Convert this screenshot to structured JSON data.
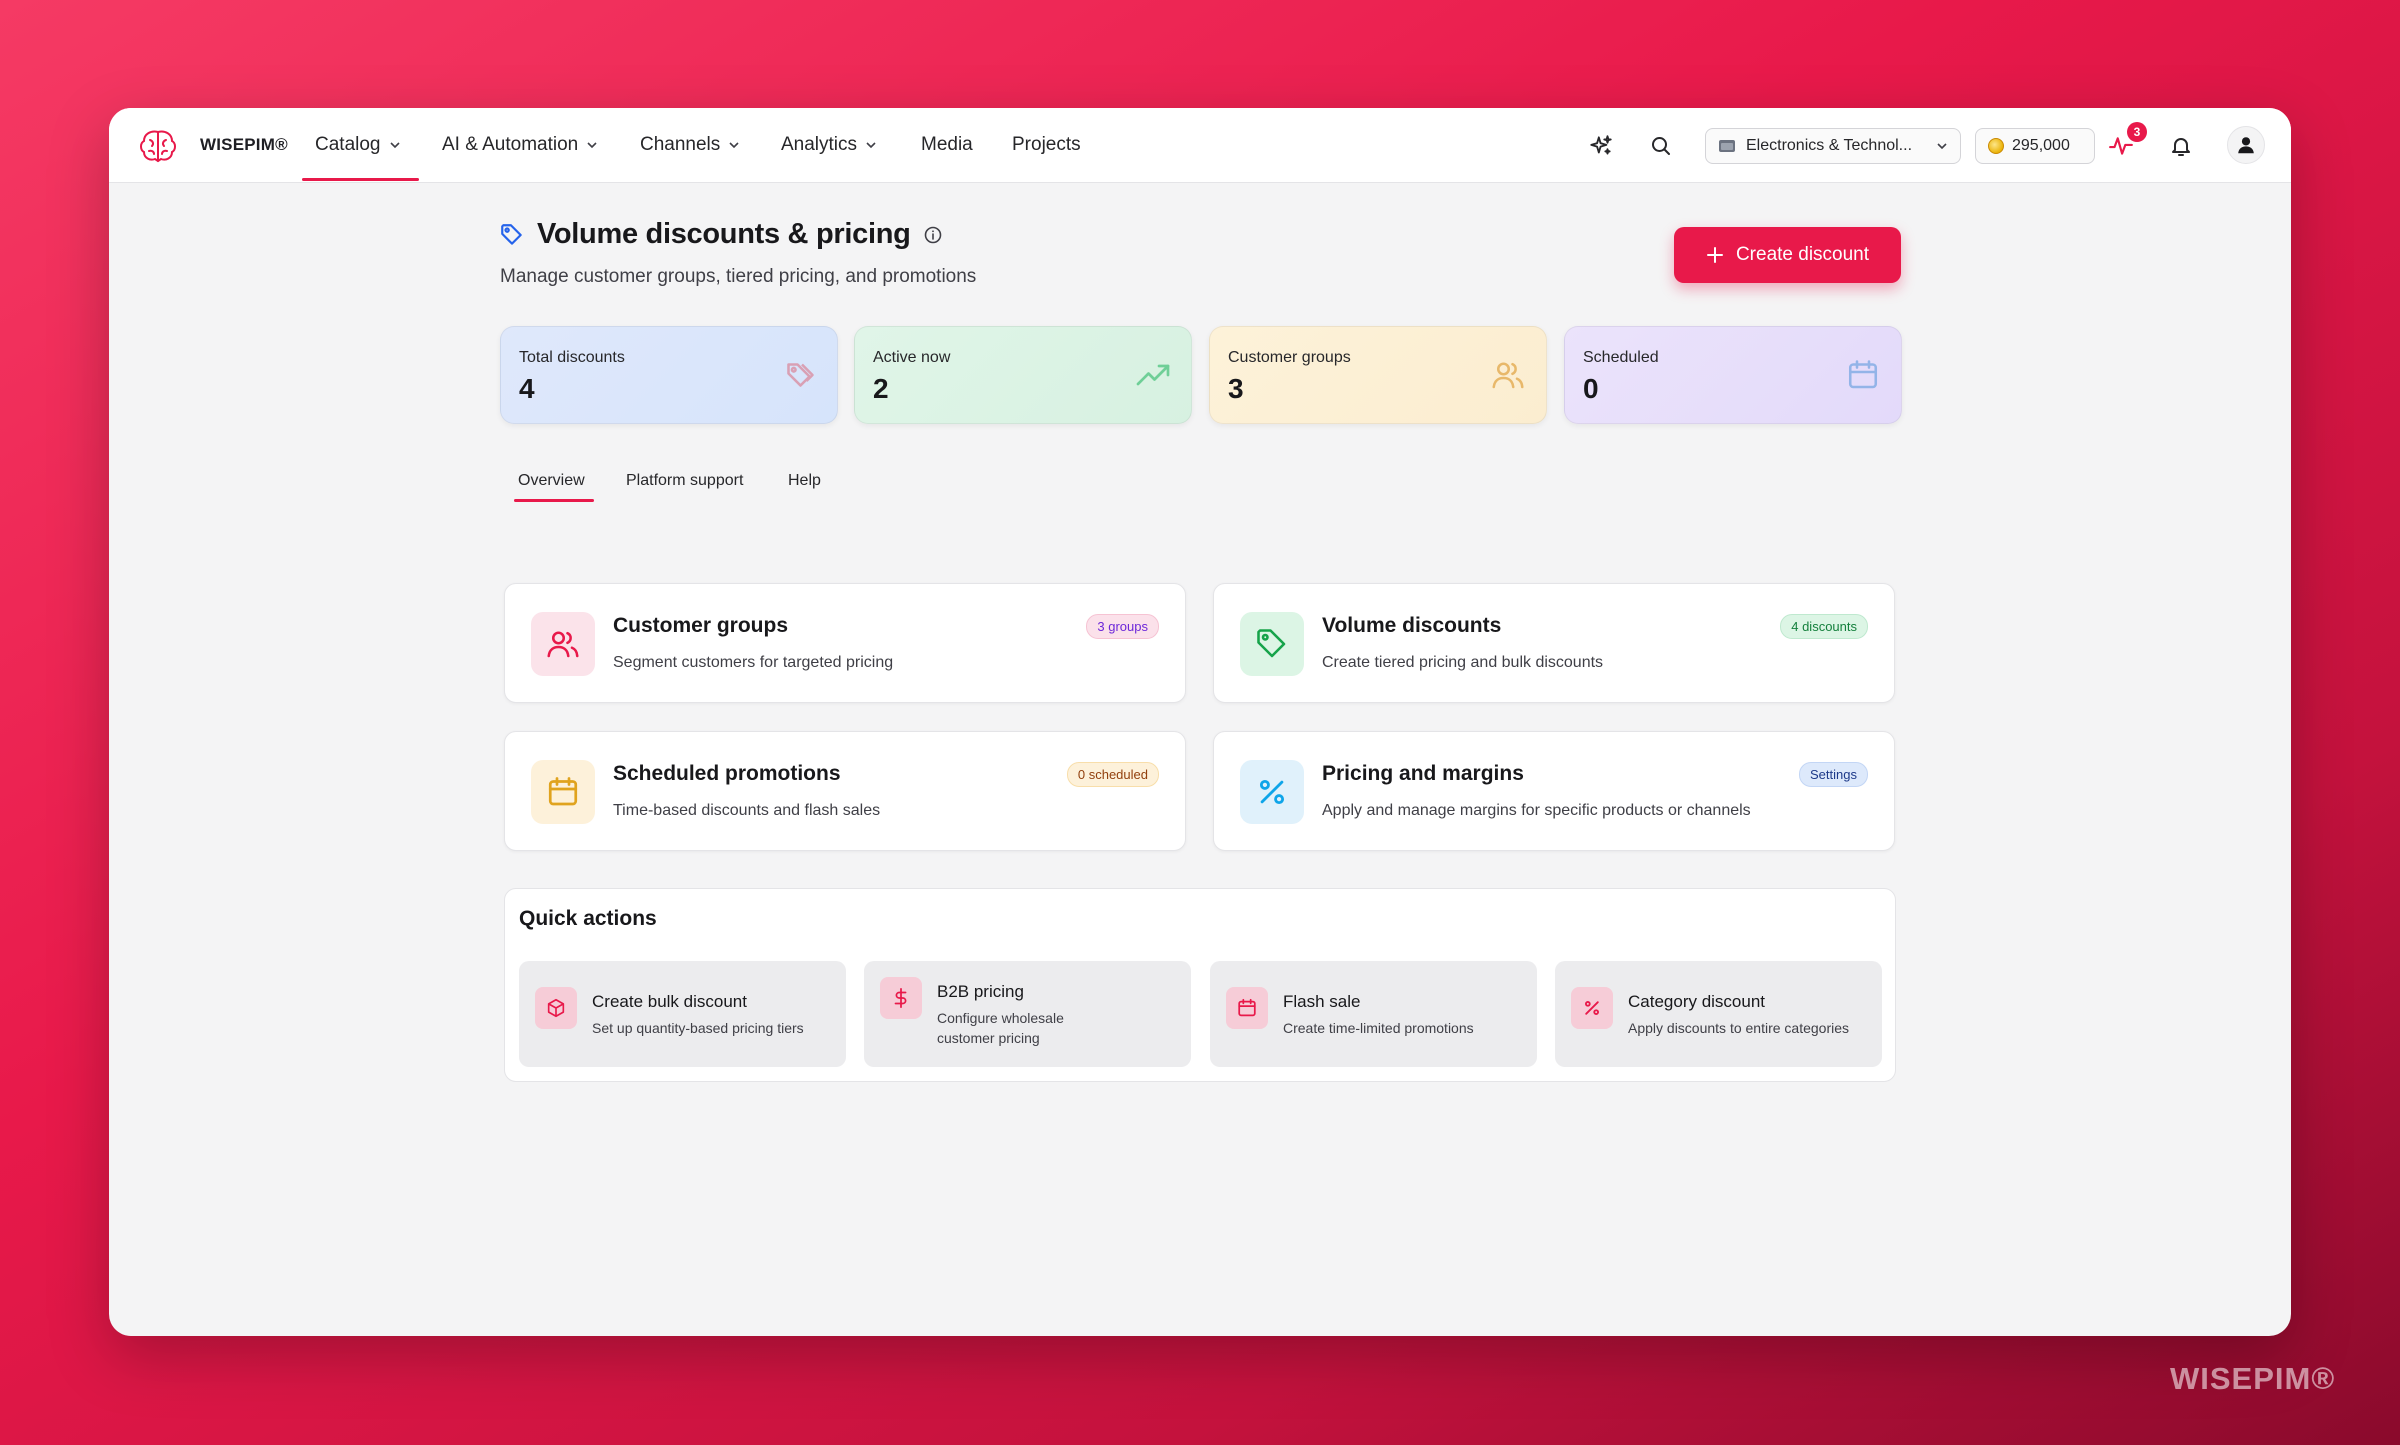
{
  "nav": {
    "brand": "WISEPIM®",
    "items": [
      {
        "label": "Catalog"
      },
      {
        "label": "AI & Automation"
      },
      {
        "label": "Channels"
      },
      {
        "label": "Analytics"
      },
      {
        "label": "Media"
      },
      {
        "label": "Projects"
      }
    ],
    "org_select": "Electronics & Technol...",
    "credits": "295,000",
    "activity_count": "3"
  },
  "page": {
    "title": "Volume discounts & pricing",
    "subtitle": "Manage customer groups, tiered pricing, and promotions",
    "create_button": "Create discount"
  },
  "stats": [
    {
      "label": "Total discounts",
      "value": "4"
    },
    {
      "label": "Active now",
      "value": "2"
    },
    {
      "label": "Customer groups",
      "value": "3"
    },
    {
      "label": "Scheduled",
      "value": "0"
    }
  ],
  "tabs": [
    {
      "label": "Overview"
    },
    {
      "label": "Platform support"
    },
    {
      "label": "Help"
    }
  ],
  "features": [
    {
      "title": "Customer groups",
      "desc": "Segment customers for targeted pricing",
      "pill": "3 groups"
    },
    {
      "title": "Volume discounts",
      "desc": "Create tiered pricing and bulk discounts",
      "pill": "4 discounts"
    },
    {
      "title": "Scheduled promotions",
      "desc": "Time-based discounts and flash sales",
      "pill": "0 scheduled"
    },
    {
      "title": "Pricing and margins",
      "desc": "Apply and manage margins for specific products or channels",
      "pill": "Settings"
    }
  ],
  "quick_actions": {
    "title": "Quick actions",
    "items": [
      {
        "title": "Create bulk discount",
        "desc": "Set up quantity-based pricing tiers"
      },
      {
        "title": "B2B pricing",
        "desc": "Configure wholesale customer pricing"
      },
      {
        "title": "Flash sale",
        "desc": "Create time-limited promotions"
      },
      {
        "title": "Category discount",
        "desc": "Apply discounts to entire categories"
      }
    ]
  },
  "watermark": "WISEPIM®",
  "colors": {
    "accent": "#e8194a",
    "stat_blue": "#dbe7fb",
    "stat_green": "#dcf3e4",
    "stat_yellow": "#fcf0d4",
    "stat_purple": "#e6defa"
  }
}
